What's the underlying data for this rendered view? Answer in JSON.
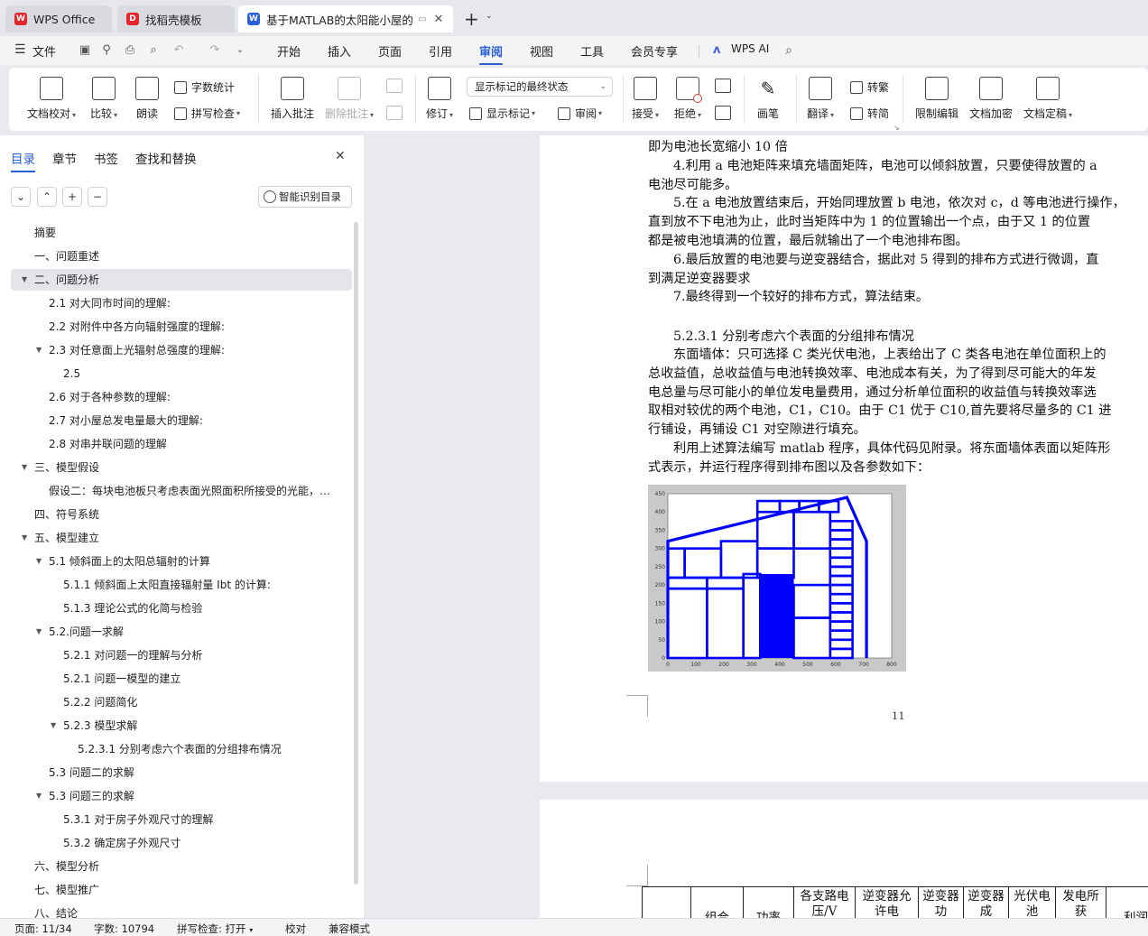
{
  "tabs": [
    {
      "label": "WPS Office"
    },
    {
      "label": "找稻壳模板"
    },
    {
      "label": "基于MATLAB的太阳能小屋的"
    }
  ],
  "menubar": {
    "file": "文件",
    "items": [
      "开始",
      "插入",
      "页面",
      "引用",
      "审阅",
      "视图",
      "工具",
      "会员专享"
    ],
    "active": "审阅",
    "ai": "WPS AI"
  },
  "ribbon": {
    "doc_check": "文档校对",
    "compare": "比较",
    "read_aloud": "朗读",
    "word_count": "字数统计",
    "spell_check": "拼写检查",
    "insert_comment": "插入批注",
    "delete_comment": "删除批注",
    "revise": "修订",
    "markup_state": "显示标记的最终状态",
    "show_markup": "显示标记",
    "review": "审阅",
    "accept": "接受",
    "reject": "拒绝",
    "pen": "画笔",
    "translate": "翻译",
    "to_traditional": "转繁",
    "to_simplified": "转简",
    "restrict_edit": "限制编辑",
    "encrypt": "文档加密",
    "finalize": "文档定稿"
  },
  "panel": {
    "tabs": [
      "目录",
      "章节",
      "书签",
      "查找和替换"
    ],
    "smart_toc": "智能识别目录",
    "toc": [
      {
        "text": "摘要",
        "level": 1
      },
      {
        "text": "一、问题重述",
        "level": 1
      },
      {
        "text": "二、问题分析",
        "level": 1,
        "caret": true,
        "selected": true
      },
      {
        "text": "2.1 对大同市时间的理解:",
        "level": 2
      },
      {
        "text": "2.2 对附件中各方向辐射强度的理解:",
        "level": 2
      },
      {
        "text": "2.3 对任意面上光辐射总强度的理解:",
        "level": 2,
        "caret": true
      },
      {
        "text": "2.5",
        "level": 3
      },
      {
        "text": "2.6 对于各种参数的理解:",
        "level": 2
      },
      {
        "text": "2.7 对小屋总发电量最大的理解:",
        "level": 2
      },
      {
        "text": "2.8 对串并联问题的理解",
        "level": 2
      },
      {
        "text": "三、模型假设",
        "level": 1,
        "caret": true
      },
      {
        "text": "假设二：每块电池板只考虑表面光照面积所接受的光能，不...",
        "level": 2
      },
      {
        "text": "四、符号系统",
        "level": 1
      },
      {
        "text": "五、模型建立",
        "level": 1,
        "caret": true
      },
      {
        "text": "5.1 倾斜面上的太阳总辐射的计算",
        "level": 2,
        "caret": true
      },
      {
        "text": "5.1.1 倾斜面上太阳直接辐射量 Ibt 的计算:",
        "level": 3
      },
      {
        "text": "5.1.3 理论公式的化简与检验",
        "level": 3
      },
      {
        "text": "5.2.问题一求解",
        "level": 2,
        "caret": true
      },
      {
        "text": "5.2.1 对问题一的理解与分析",
        "level": 3
      },
      {
        "text": "5.2.1 问题一模型的建立",
        "level": 3
      },
      {
        "text": "5.2.2 问题简化",
        "level": 3
      },
      {
        "text": "5.2.3 模型求解",
        "level": 3,
        "caret": true
      },
      {
        "text": "5.2.3.1 分别考虑六个表面的分组排布情况",
        "level": 4
      },
      {
        "text": "5.3 问题二的求解",
        "level": 2
      },
      {
        "text": "5.3 问题三的求解",
        "level": 2,
        "caret": true
      },
      {
        "text": "5.3.1 对于房子外观尺寸的理解",
        "level": 3
      },
      {
        "text": "5.3.2 确定房子外观尺寸",
        "level": 3
      },
      {
        "text": "六、模型分析",
        "level": 1
      },
      {
        "text": "七、模型推广",
        "level": 1
      },
      {
        "text": "八、结论",
        "level": 1
      }
    ]
  },
  "document": {
    "lines": [
      {
        "text": "即为电池长宽缩小 10 倍",
        "indent": false
      },
      {
        "text": "4.利用 a 电池矩阵来填充墙面矩阵，电池可以倾斜放置，只要使得放置的 a",
        "indent": true
      },
      {
        "text": "电池尽可能多。",
        "indent": false
      },
      {
        "text": "5.在 a 电池放置结束后，开始同理放置 b 电池，依次对 c，d 等电池进行操作，",
        "indent": true
      },
      {
        "text": "直到放不下电池为止，此时当矩阵中为 1 的位置输出一个点，由于又 1 的位置",
        "indent": false
      },
      {
        "text": "都是被电池填满的位置，最后就输出了一个电池排布图。",
        "indent": false
      },
      {
        "text": "6.最后放置的电池要与逆变器结合，据此对 5 得到的排布方式进行微调，直",
        "indent": true
      },
      {
        "text": "到满足逆变器要求",
        "indent": false
      },
      {
        "text": "7.最终得到一个较好的排布方式，算法结束。",
        "indent": true
      }
    ],
    "heading": "5.2.3.1 分别考虑六个表面的分组排布情况",
    "para_lines": [
      {
        "text": "东面墙体：只可选择 C 类光伏电池，上表给出了 C 类各电池在单位面积上的",
        "indent": true
      },
      {
        "text": "总收益值，总收益值与电池转换效率、电池成本有关，为了得到尽可能大的年发",
        "indent": false
      },
      {
        "text": "电总量与尽可能小的单位发电量费用，通过分析单位面积的收益值与转换效率选",
        "indent": false
      },
      {
        "text": "取相对较优的两个电池，C1，C10。由于 C1 优于 C10,首先要将尽量多的 C1 进",
        "indent": false
      },
      {
        "text": "行铺设，再铺设 C1 对空隙进行填充。",
        "indent": false
      },
      {
        "text": "利用上述算法编写 matlab 程序，具体代码见附录。将东面墙体表面以矩阵形",
        "indent": true
      },
      {
        "text": "式表示，并运行程序得到排布图以及各参数如下：",
        "indent": false
      }
    ],
    "page_number": "11",
    "table_headers": [
      "",
      "组合",
      "功率",
      "各支路电压/V",
      "逆变器允许电",
      "逆变器功",
      "逆变器成",
      "光伏电池",
      "发电所获",
      "利润"
    ]
  },
  "chart_data": {
    "type": "scatter",
    "title": "",
    "xlabel": "",
    "ylabel": "",
    "xlim": [
      0,
      800
    ],
    "ylim": [
      0,
      450
    ],
    "xticks": [
      "0",
      "100",
      "200",
      "300",
      "400",
      "500",
      "600",
      "700",
      "800"
    ],
    "yticks": [
      "0",
      "50",
      "100",
      "150",
      "200",
      "250",
      "300",
      "350",
      "400",
      "450"
    ],
    "color": "#0000ff",
    "outline": [
      [
        0,
        0
      ],
      [
        0,
        320
      ],
      [
        640,
        440
      ],
      [
        710,
        320
      ],
      [
        710,
        0
      ]
    ],
    "rects": [
      [
        0,
        0,
        140,
        190
      ],
      [
        140,
        0,
        270,
        190
      ],
      [
        270,
        0,
        330,
        230
      ],
      [
        0,
        190,
        140,
        220
      ],
      [
        140,
        190,
        270,
        220
      ],
      [
        0,
        220,
        60,
        300
      ],
      [
        60,
        220,
        190,
        300
      ],
      [
        190,
        220,
        320,
        320
      ],
      [
        320,
        220,
        450,
        300
      ],
      [
        320,
        300,
        450,
        400
      ],
      [
        450,
        300,
        580,
        400
      ],
      [
        320,
        400,
        400,
        430
      ],
      [
        400,
        400,
        470,
        430
      ],
      [
        470,
        400,
        540,
        430
      ],
      [
        540,
        400,
        610,
        430
      ],
      [
        580,
        0,
        660,
        25
      ],
      [
        580,
        25,
        660,
        50
      ],
      [
        580,
        50,
        660,
        75
      ],
      [
        580,
        75,
        660,
        100
      ],
      [
        580,
        100,
        660,
        125
      ],
      [
        580,
        125,
        660,
        150
      ],
      [
        580,
        150,
        660,
        175
      ],
      [
        580,
        175,
        660,
        200
      ],
      [
        580,
        200,
        660,
        225
      ],
      [
        580,
        225,
        660,
        250
      ],
      [
        580,
        250,
        660,
        275
      ],
      [
        580,
        275,
        660,
        300
      ],
      [
        580,
        300,
        660,
        325
      ],
      [
        580,
        325,
        660,
        350
      ],
      [
        580,
        350,
        660,
        375
      ],
      [
        450,
        0,
        580,
        110
      ],
      [
        450,
        110,
        580,
        200
      ]
    ],
    "solid": [
      330,
      0,
      450,
      230
    ]
  },
  "status": {
    "page": "页面: 11/34",
    "words": "字数: 10794",
    "spell": "拼写检查: 打开",
    "proof": "校对",
    "compat": "兼容模式"
  }
}
